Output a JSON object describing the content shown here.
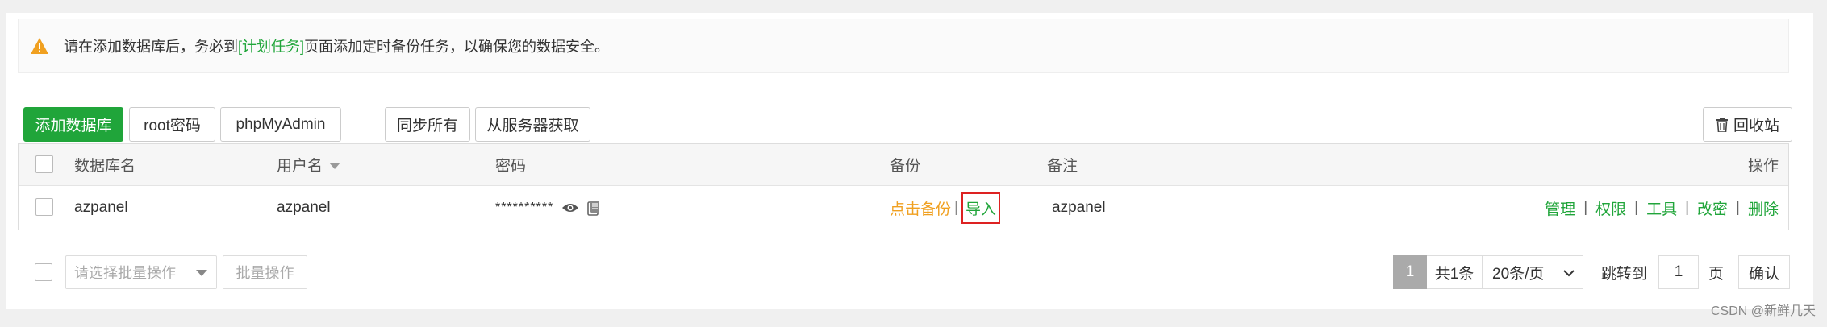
{
  "alert": {
    "prefix": "请在添加数据库后，务必到",
    "link": "[计划任务]",
    "suffix": "页面添加定时备份任务，以确保您的数据安全。"
  },
  "toolbar": {
    "add_db": "添加数据库",
    "root_pwd": "root密码",
    "phpmyadmin": "phpMyAdmin",
    "sync_all": "同步所有",
    "fetch_server": "从服务器获取",
    "recycle": "回收站"
  },
  "table": {
    "headers": {
      "name": "数据库名",
      "user": "用户名",
      "password": "密码",
      "backup": "备份",
      "note": "备注",
      "ops": "操作"
    },
    "rows": [
      {
        "name": "azpanel",
        "user": "azpanel",
        "password": "**********",
        "backup_action": "点击备份",
        "import_action": "导入",
        "note": "azpanel",
        "ops": [
          "管理",
          "权限",
          "工具",
          "改密",
          "删除"
        ]
      }
    ]
  },
  "batch": {
    "placeholder": "请选择批量操作",
    "button": "批量操作"
  },
  "pagination": {
    "current_page": "1",
    "total": "共1条",
    "page_size": "20条/页",
    "jump_label": "跳转到",
    "jump_value": "1",
    "page_unit": "页",
    "confirm": "确认"
  },
  "watermark": "CSDN @新鲜几天",
  "colors": {
    "primary": "#20a53a",
    "warning": "#f0a020",
    "highlight_border": "#dd2222"
  }
}
